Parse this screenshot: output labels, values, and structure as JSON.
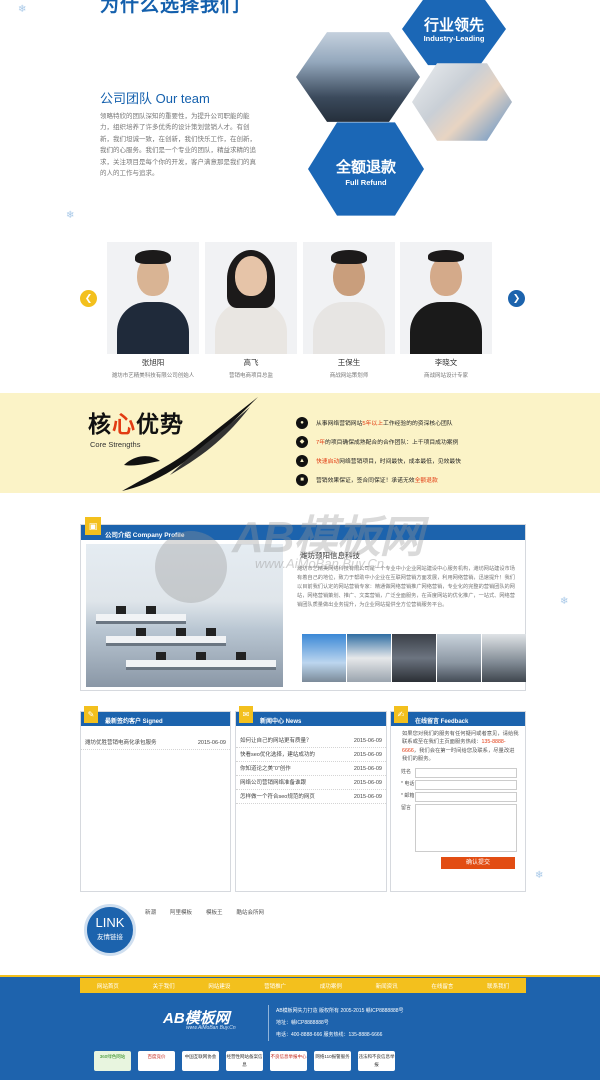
{
  "why_choose": {
    "title": "为什么选择我们"
  },
  "team": {
    "heading": "公司团队   Our team",
    "text": "领略特欣的团队深知的重要性，为提升公司职能的能力，组织培养了许多优秀的设计策划营销人才。有创新，我们坦诚一致，在创新，我们快乐工作，在创新，我们的心服务。我们是一个专业的团队，精益求精的追求，关注项目是每个你的开发，客户满意那是我们的真的人的工作与追求。"
  },
  "hexes": {
    "industry_cn": "行业领先",
    "industry_en": "Industry-Leading",
    "refund_cn": "全额退款",
    "refund_en": "Full Refund"
  },
  "people": [
    {
      "name": "张旭阳",
      "title": "潍坊市艺精美科技有限公司创始人"
    },
    {
      "name": "高飞",
      "title": "营销电商项目总监"
    },
    {
      "name": "王保生",
      "title": "商战网站策划师"
    },
    {
      "name": "李晓文",
      "title": "商战网站设计专家"
    }
  ],
  "core": {
    "title_a": "核",
    "title_b": "心",
    "title_c": "优势",
    "subtitle": "Core Strengths",
    "items": [
      {
        "a": "从事网络营销网站",
        "hl": "5年以上",
        "b": "工作经验的的资深核心团队"
      },
      {
        "a": "",
        "hl": "7年",
        "b": "的项目确保成熟配合的合作团队：上千项目成功案例"
      },
      {
        "a": "",
        "hl": "快速启动",
        "b": "网络营销项目，时间最快，成本最低，见效最快"
      },
      {
        "a": "营销效果保证，签合同保证！承诺无效",
        "hl": "全额退款",
        "b": ""
      }
    ]
  },
  "profile": {
    "title": "公司介绍 Company Profile",
    "company": "潍坊颈阳信息科技",
    "text": "潍坊市艺精美网络科技有限公司是一个专业中小企业网站建设中心服务机构，潍坊网站建设市场有着自己的地位，致力于帮助中小企业在互联网营销方面发展，利用网络营销，迅速提升！我们以目前我们认定的网站营销专家：精通做网络营销推广网络营销，专业化的完整的营销团队的网站，网络营销策划、推广、文案营销，广泛全面服务，在百度网站的优化推广，一站式、网络营销团队质量做出业务提升，为企业网站提供全方位营销服务平台。"
  },
  "watermark": {
    "text": "AB模板网",
    "url": "www.AiMoBan Buy.Cn"
  },
  "signed": {
    "title": "最新签约客户 Signed",
    "rows": [
      {
        "text": "潍坊优胜营销电商化承包服务",
        "date": "2015-06-09"
      }
    ]
  },
  "news": {
    "title": "新闻中心 News",
    "rows": [
      {
        "text": "如何让自己的网站更有质量？",
        "date": "2015-06-09"
      },
      {
        "text": "快看seo优化选择，建站成功的",
        "date": "2015-06-09"
      },
      {
        "text": "你知道论之美“0”创作",
        "date": "2015-06-09"
      },
      {
        "text": "网络公司营销网络准备谁跟",
        "date": "2015-06-09"
      },
      {
        "text": "怎样做一个符合seo规范的网页",
        "date": "2015-06-09"
      }
    ]
  },
  "feedback": {
    "title": "在线留言 Feedback",
    "text_a": "如果您对我们的服务有任何疑问或者意见，请给我联系或至在我们主页面服务热线：",
    "phone": "135-8888-6666",
    "text_b": "，我们会在第一时间给您及联系，尽量改进我们的服务。",
    "labels": [
      "姓名",
      "* 电话",
      "* 邮箱",
      "留言"
    ],
    "submit": "确认提交"
  },
  "links": {
    "en": "LINK",
    "cn": "友情链接",
    "items": [
      "新潮",
      "阿里模板",
      "模板王",
      "酷站会所网"
    ]
  },
  "footer": {
    "nav": [
      "网站首页",
      "关于我们",
      "网站建设",
      "营销推广",
      "成功案例",
      "新闻资讯",
      "在线留言",
      "联系我们"
    ],
    "logo": "AB模板网",
    "logo_sub": "www.AiMoBan Buy.Cn",
    "copyright": "AB模板网失力打造 版权所有 2005-2015 赣ICP8888888号",
    "address": "地址：赣ICP8888888号",
    "phone": "电话：400-8888-666 服务热线：135-8888-6666",
    "certs": [
      "360绿色网站",
      "百度竞价",
      "中国互联网协会",
      "经营性网站备案信息",
      "不良信息举报中心",
      "网络110报警服务",
      "违法和不良信息举报"
    ]
  }
}
